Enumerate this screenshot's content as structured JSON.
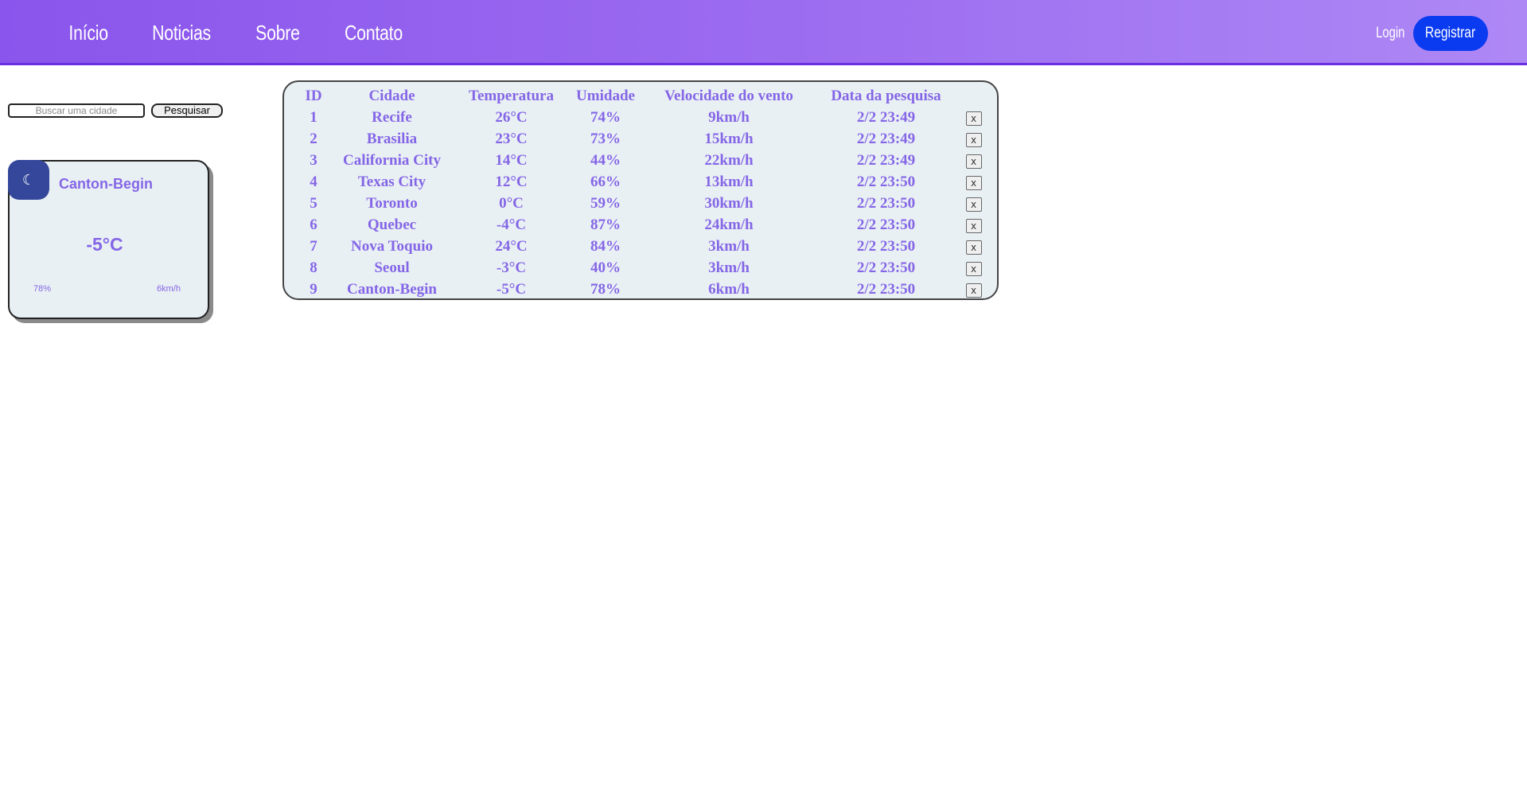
{
  "nav": {
    "links": [
      "Início",
      "Noticias",
      "Sobre",
      "Contato"
    ],
    "login_label": "Login",
    "register_label": "Registrar"
  },
  "search": {
    "placeholder": "Buscar uma cidade",
    "value": "",
    "button_label": "Pesquisar"
  },
  "weather_card": {
    "icon": "moon-icon",
    "city": "Canton-Begin",
    "temperature": "-5°C",
    "humidity": "78%",
    "wind": "6km/h"
  },
  "history_table": {
    "headers": [
      "ID",
      "Cidade",
      "Temperatura",
      "Umidade",
      "Velocidade do vento",
      "Data da pesquisa"
    ],
    "delete_label": "x",
    "rows": [
      {
        "id": "1",
        "city": "Recife",
        "temp": "26°C",
        "humidity": "74%",
        "wind": "9km/h",
        "date": "2/2 23:49"
      },
      {
        "id": "2",
        "city": "Brasilia",
        "temp": "23°C",
        "humidity": "73%",
        "wind": "15km/h",
        "date": "2/2 23:49"
      },
      {
        "id": "3",
        "city": "California City",
        "temp": "14°C",
        "humidity": "44%",
        "wind": "22km/h",
        "date": "2/2 23:49"
      },
      {
        "id": "4",
        "city": "Texas City",
        "temp": "12°C",
        "humidity": "66%",
        "wind": "13km/h",
        "date": "2/2 23:50"
      },
      {
        "id": "5",
        "city": "Toronto",
        "temp": "0°C",
        "humidity": "59%",
        "wind": "30km/h",
        "date": "2/2 23:50"
      },
      {
        "id": "6",
        "city": "Quebec",
        "temp": "-4°C",
        "humidity": "87%",
        "wind": "24km/h",
        "date": "2/2 23:50"
      },
      {
        "id": "7",
        "city": "Nova Toquio",
        "temp": "24°C",
        "humidity": "84%",
        "wind": "3km/h",
        "date": "2/2 23:50"
      },
      {
        "id": "8",
        "city": "Seoul",
        "temp": "-3°C",
        "humidity": "40%",
        "wind": "3km/h",
        "date": "2/2 23:50"
      },
      {
        "id": "9",
        "city": "Canton-Begin",
        "temp": "-5°C",
        "humidity": "78%",
        "wind": "6km/h",
        "date": "2/2 23:50"
      }
    ]
  },
  "colors": {
    "navbar_gradient_start": "#8a55ec",
    "navbar_gradient_end": "#ae88f5",
    "register_button": "#0b3bf0",
    "text_accent": "#8466e6",
    "card_background": "#e9f0f4",
    "moon_badge": "#34479a"
  }
}
